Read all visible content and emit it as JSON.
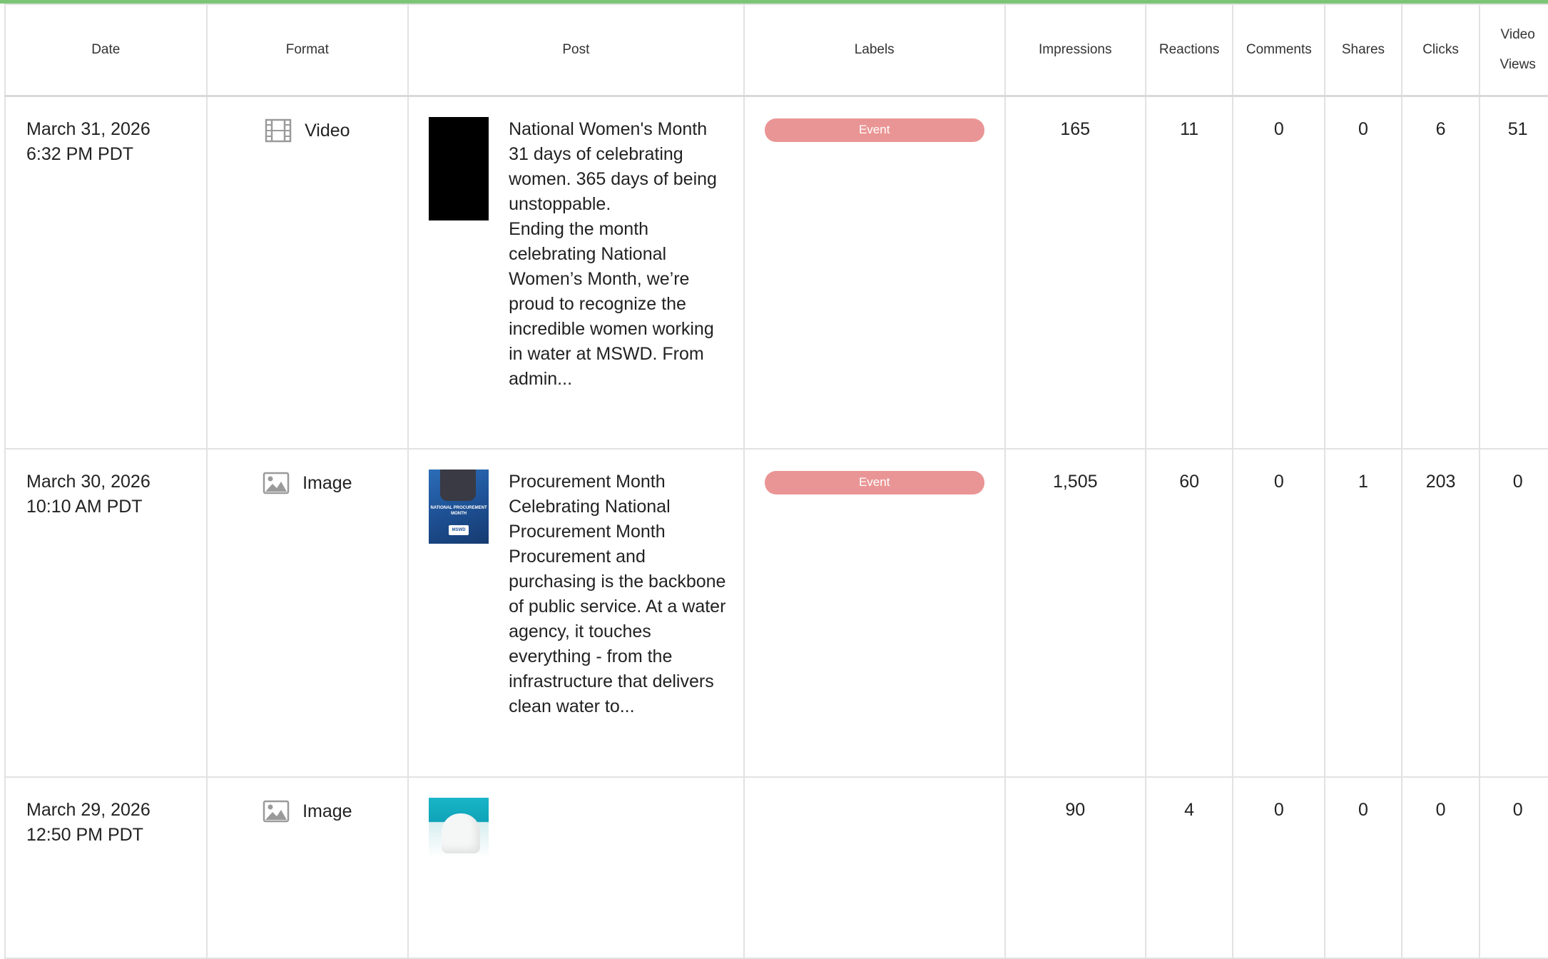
{
  "columns": {
    "date": "Date",
    "format": "Format",
    "post": "Post",
    "labels": "Labels",
    "impressions": "Impressions",
    "reactions": "Reactions",
    "comments": "Comments",
    "shares": "Shares",
    "clicks": "Clicks",
    "video_views": "Video Views"
  },
  "rows": [
    {
      "date": "March 31, 2026",
      "time": "6:32 PM PDT",
      "format": "Video",
      "format_icon": "film-icon",
      "post_text": "National Women's Month 31 days of celebrating women. 365 days of being unstoppable.\nEnding the month celebrating National Women’s Month, we’re proud to recognize the incredible women working in water at MSWD. From admin...",
      "label": "Event",
      "impressions": "165",
      "reactions": "11",
      "comments": "0",
      "shares": "0",
      "clicks": "6",
      "video_views": "51"
    },
    {
      "date": "March 30, 2026",
      "time": "10:10 AM PDT",
      "format": "Image",
      "format_icon": "image-icon",
      "post_text": "Procurement Month Celebrating National Procurement Month Procurement and purchasing is the backbone of public service. At a water agency, it touches everything - from the infrastructure that delivers clean water to...",
      "thumb_caption": "NATIONAL PROCUREMENT MONTH",
      "thumb_logo": "MSWD",
      "label": "Event",
      "impressions": "1,505",
      "reactions": "60",
      "comments": "0",
      "shares": "1",
      "clicks": "203",
      "video_views": "0"
    },
    {
      "date": "March 29, 2026",
      "time": "12:50 PM PDT",
      "format": "Image",
      "format_icon": "image-icon",
      "post_text": "",
      "label": "",
      "impressions": "90",
      "reactions": "4",
      "comments": "0",
      "shares": "0",
      "clicks": "0",
      "video_views": "0"
    }
  ],
  "colors": {
    "top_accent": "#7cc576",
    "label_pill": "#ea9595",
    "grid_line": "#e2e2e2"
  }
}
